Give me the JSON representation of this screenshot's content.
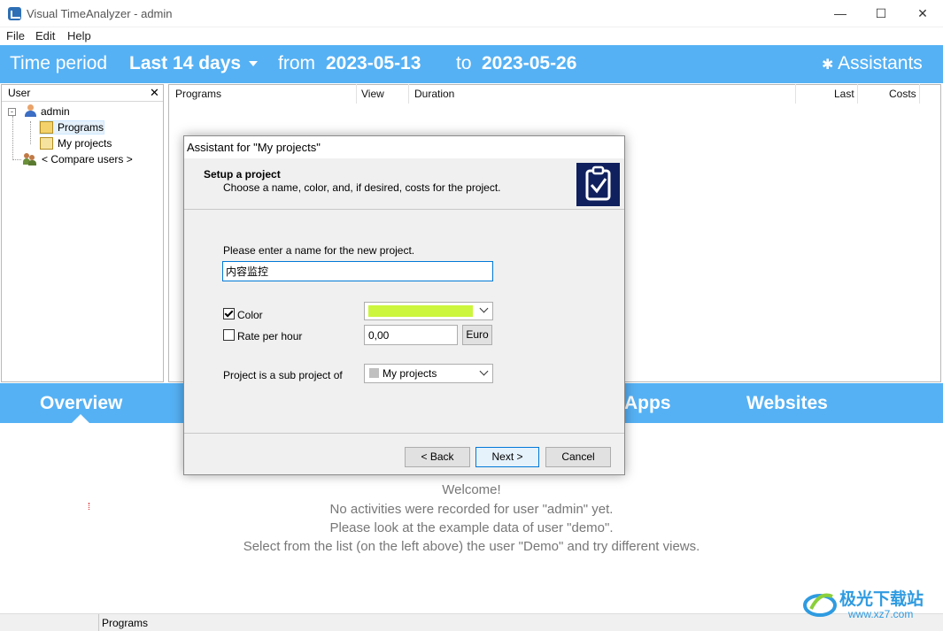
{
  "window": {
    "title": "Visual TimeAnalyzer - admin",
    "minimize": "—",
    "maximize": "☐",
    "close": "✕"
  },
  "menu": [
    "File",
    "Edit",
    "Help"
  ],
  "period_bar": {
    "label": "Time period",
    "range": "Last 14 days",
    "from_label": "from",
    "from_date": "2023-05-13",
    "to_label": "to",
    "to_date": "2023-05-26",
    "assistants": "Assistants"
  },
  "user_panel": {
    "header": "User",
    "close": "✕",
    "tree": {
      "root": "admin",
      "programs": "Programs",
      "my_projects": "My projects",
      "compare": "< Compare users >"
    }
  },
  "programs_table": {
    "columns": [
      "Programs",
      "View",
      "Duration",
      "Last",
      "Costs"
    ]
  },
  "tabs": {
    "overview": "Overview",
    "apps": "Apps",
    "websites": "Websites"
  },
  "welcome": [
    "Welcome!",
    "No activities were recorded for user \"admin\" yet.",
    "Please look at the example data of user \"demo\".",
    "Select from the list (on the left above) the user \"Demo\" and try different views."
  ],
  "statusbar": {
    "section": "Programs"
  },
  "dialog": {
    "title": "Assistant for \"My projects\"",
    "heading": "Setup a project",
    "subheading": "Choose a name, color, and, if desired, costs for the project.",
    "name_prompt": "Please enter a name for the new project.",
    "name_value": "内容监控",
    "color_label": "Color",
    "color_checked": true,
    "color_value": "#ccf53d",
    "rate_label": "Rate per hour",
    "rate_checked": false,
    "rate_value": "0,00",
    "currency": "Euro",
    "subproject_label": "Project is a sub project of",
    "subproject_value": "My projects",
    "back": "< Back",
    "next": "Next >",
    "cancel": "Cancel"
  },
  "watermark": {
    "site_cn": "极光下载站",
    "site_url": "www.xz7.com"
  },
  "colors": {
    "accent_blue": "#55b1f4",
    "project_color": "#ccf53d"
  }
}
